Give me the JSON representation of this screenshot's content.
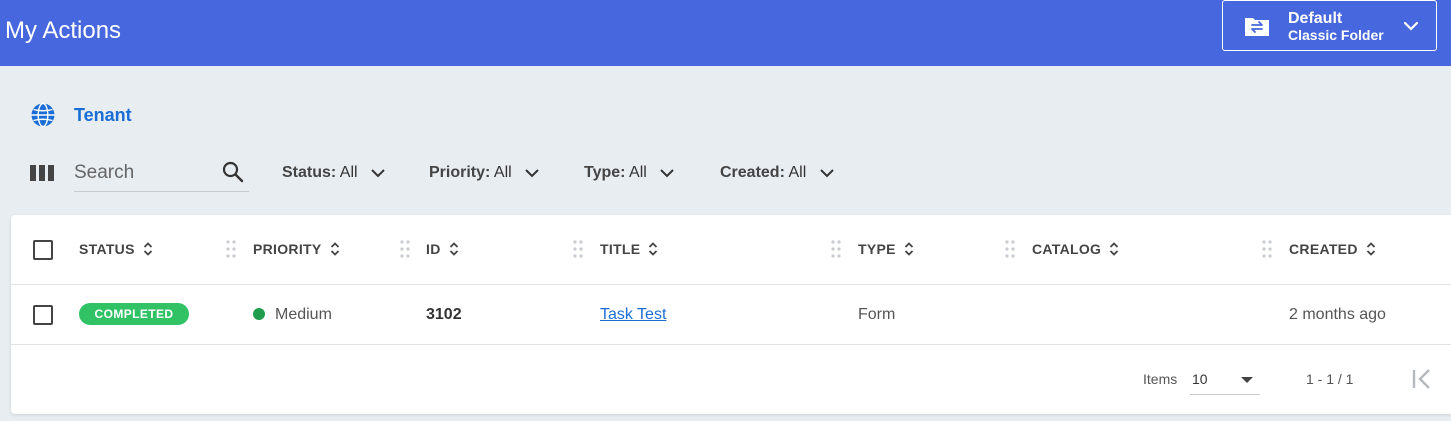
{
  "header": {
    "title": "My Actions",
    "folder": {
      "name": "Default",
      "type": "Classic Folder"
    }
  },
  "tenant": {
    "label": "Tenant"
  },
  "toolbar": {
    "search_placeholder": "Search",
    "filters": [
      {
        "label": "Status:",
        "value": "All"
      },
      {
        "label": "Priority:",
        "value": "All"
      },
      {
        "label": "Type:",
        "value": "All"
      },
      {
        "label": "Created:",
        "value": "All"
      }
    ]
  },
  "table": {
    "columns": [
      "STATUS",
      "PRIORITY",
      "ID",
      "TITLE",
      "TYPE",
      "CATALOG",
      "CREATED"
    ],
    "rows": [
      {
        "status": "COMPLETED",
        "priority": "Medium",
        "id": "3102",
        "title": "Task Test",
        "type": "Form",
        "catalog": "",
        "created": "2 months ago"
      }
    ]
  },
  "pagination": {
    "items_label": "Items",
    "page_size": "10",
    "range": "1 - 1 / 1"
  },
  "colors": {
    "header_bg": "#4667dd",
    "background": "#e8edf2",
    "link": "#1a6dd4",
    "completed_badge": "#32c266",
    "priority_medium": "#1e9e4d"
  },
  "icons": [
    "folder-swap-icon",
    "chevron-down-icon",
    "globe-icon",
    "columns-icon",
    "search-icon",
    "sort-icon",
    "drag-handle-icon",
    "first-page-icon"
  ]
}
